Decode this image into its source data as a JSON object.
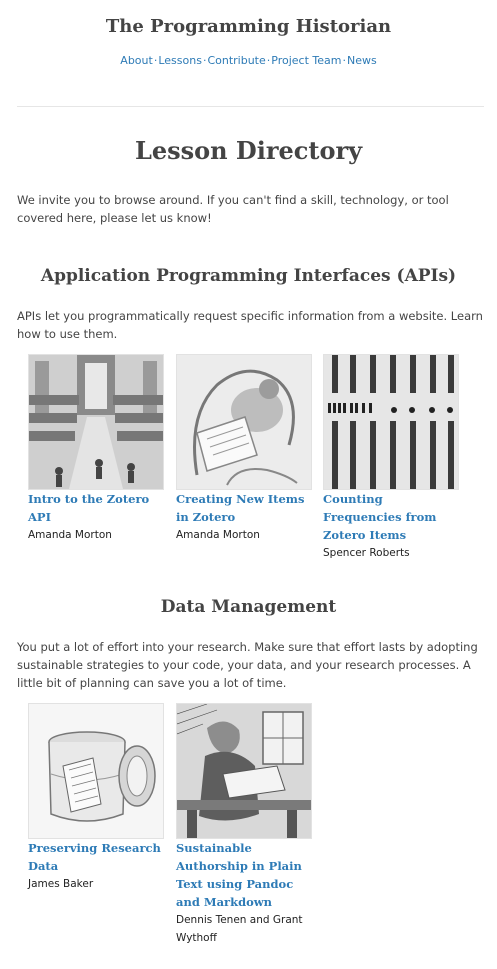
{
  "site": {
    "title": "The Programming Historian",
    "nav": [
      "About",
      "Lessons",
      "Contribute",
      "Project Team",
      "News"
    ],
    "nav_separator": "·"
  },
  "page": {
    "title": "Lesson Directory",
    "intro": "We invite you to browse around. If you can't find a skill, technology, or tool covered here, please let us know!"
  },
  "sections": [
    {
      "title": "Application Programming Interfaces (APIs)",
      "description": "APIs let you programmatically request specific information from a website. Learn how to use them.",
      "lessons": [
        {
          "title": "Intro to the Zotero API",
          "author": "Amanda Morton",
          "image_icon": "library-engraving"
        },
        {
          "title": "Creating New Items in Zotero",
          "author": "Amanda Morton",
          "image_icon": "scribe-engraving"
        },
        {
          "title": "Counting Frequencies from Zotero Items",
          "author": "Spencer Roberts",
          "image_icon": "type-sorts"
        }
      ]
    },
    {
      "title": "Data Management",
      "description": "You put a lot of effort into your research. Make sure that effort lasts by adopting sustainable strategies to your code, your data, and your research processes. A little bit of planning can save you a lot of time.",
      "lessons": [
        {
          "title": "Preserving Research Data",
          "author": "James Baker",
          "image_icon": "scroll-box"
        },
        {
          "title": "Sustainable Authorship in Plain Text using Pandoc and Markdown",
          "author": "Dennis Tenen and Grant Wythoff",
          "image_icon": "writer-at-desk"
        }
      ]
    }
  ],
  "colors": {
    "link": "#2e7bb6",
    "heading": "#444444",
    "text": "#333333"
  }
}
